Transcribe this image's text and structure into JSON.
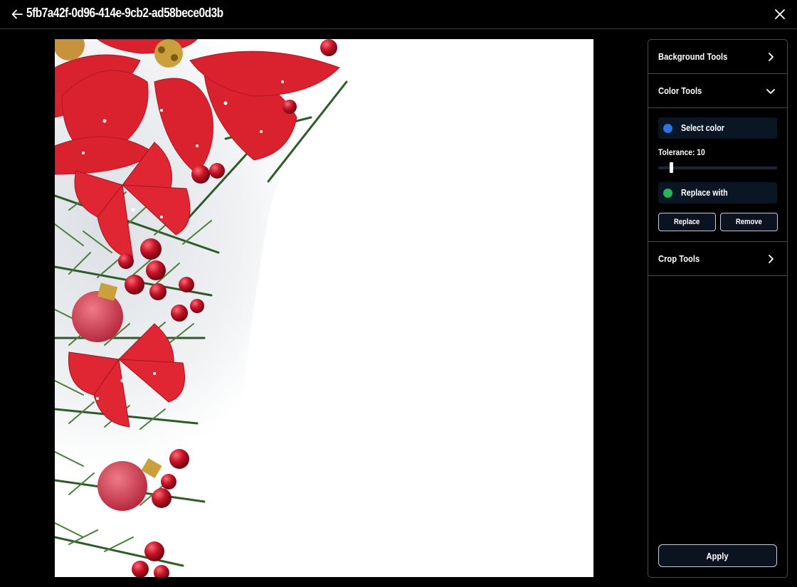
{
  "header": {
    "title": "5fb7a42f-0d96-414e-9cb2-ad58bece0d3b",
    "back_icon": "arrow-left-icon",
    "close_icon": "close-icon"
  },
  "panel": {
    "sections": {
      "background": {
        "label": "Background Tools",
        "icon": "chevron-right-icon"
      },
      "color": {
        "label": "Color Tools",
        "icon": "chevron-down-icon"
      },
      "crop": {
        "label": "Crop Tools",
        "icon": "chevron-right-icon"
      }
    },
    "select_color": {
      "label": "Select color",
      "color": "#2f73e0"
    },
    "tolerance": {
      "label": "Tolerance: 10",
      "value": 10,
      "min": 0,
      "max": 100
    },
    "replace_with": {
      "label": "Replace with",
      "color": "#27b35a"
    },
    "replace_button": "Replace",
    "remove_button": "Remove",
    "apply_button": "Apply"
  }
}
